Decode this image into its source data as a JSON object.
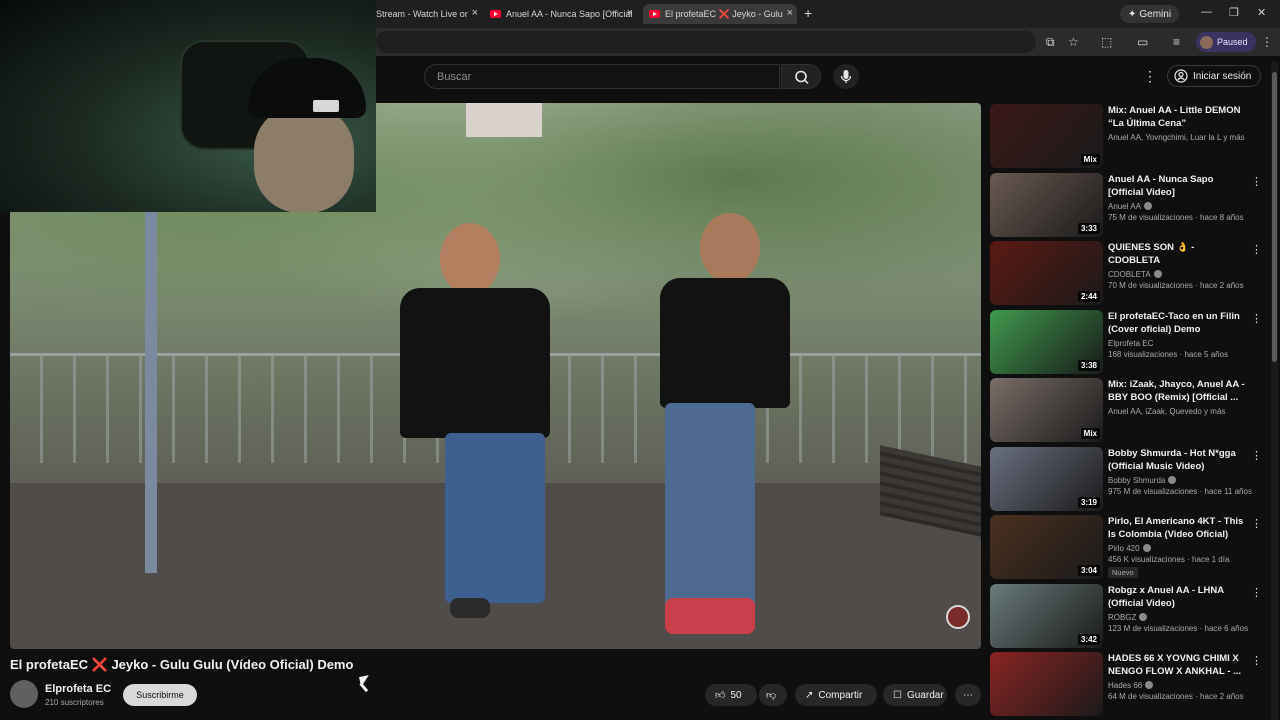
{
  "browser": {
    "tabs": [
      {
        "label": "Stream - Watch Live or",
        "active": false
      },
      {
        "label": "Anuel AA - Nunca Sapo [Official",
        "active": false
      },
      {
        "label": "El profetaEC ❌ Jeyko - Gulu",
        "active": true
      }
    ],
    "gemini_label": "Gemini",
    "paused_label": "Paused"
  },
  "masthead": {
    "search_placeholder": "Buscar",
    "signin_label": "Iniciar sesión"
  },
  "video": {
    "title_part1": "El profetaEC",
    "title_x": "❌",
    "title_part2": "Jeyko - Gulu Gulu (Vídeo Oficial) Demo",
    "channel": "Elprofeta EC",
    "subscribers": "210 suscriptores",
    "subscribe_label": "Suscribirme",
    "likes": "50",
    "share_label": "Compartir",
    "save_label": "Guardar"
  },
  "recommendations": [
    {
      "title": "Mix: Anuel AA - Little DEMON “La Última Cena”",
      "channel": "Anuel AA, Yovngchimi, Luar la L y más",
      "meta": "",
      "duration": "Mix",
      "badge": "",
      "verified": false,
      "thumb_color": "#3a1a18"
    },
    {
      "title": "Anuel AA - Nunca Sapo [Official Video]",
      "channel": "Anuel AA",
      "meta": "75 M de visualizaciones · hace 8 años",
      "duration": "3:33",
      "badge": "",
      "verified": true,
      "thumb_color": "#6a5a52"
    },
    {
      "title": "QUIENES SON 👌 - CDOBLETA",
      "channel": "CDOBLETA",
      "meta": "70 M de visualizaciones · hace 2 años",
      "duration": "2:44",
      "badge": "",
      "verified": true,
      "thumb_color": "#5a1a14"
    },
    {
      "title": "El profetaEC-Taco en un Filin (Cover oficial) Demo",
      "channel": "Elprofeta EC",
      "meta": "168 visualizaciones · hace 5 años",
      "duration": "3:38",
      "badge": "",
      "verified": false,
      "thumb_color": "#3f9a4e"
    },
    {
      "title": "Mix: iZaak, Jhayco, Anuel AA - BBY BOO (Remix) [Official ...",
      "channel": "Anuel AA, iZaak, Quevedo y más",
      "meta": "",
      "duration": "Mix",
      "badge": "",
      "verified": false,
      "thumb_color": "#7a6e68"
    },
    {
      "title": "Bobby Shmurda - Hot N*gga (Official Music Video)",
      "channel": "Bobby Shmurda",
      "meta": "975 M de visualizaciones · hace 11 años",
      "duration": "3:19",
      "badge": "",
      "verified": true,
      "thumb_color": "#6a7080"
    },
    {
      "title": "Pirlo, El Americano 4KT - This Is Colombia (Video Oficial)",
      "channel": "Pirlo 420",
      "meta": "456 K visualizaciones · hace 1 día",
      "duration": "3:04",
      "badge": "Nuevo",
      "verified": true,
      "thumb_color": "#4a3020"
    },
    {
      "title": "Robgz x Anuel AA - LHNA (Official Video)",
      "channel": "ROBGZ",
      "meta": "123 M de visualizaciones · hace 6 años",
      "duration": "3:42",
      "badge": "",
      "verified": true,
      "thumb_color": "#6a7a7a"
    },
    {
      "title": "HADES 66 X YOVNG CHIMI X NENGO FLOW X ANKHAL - ...",
      "channel": "Hades 66",
      "meta": "64 M de visualizaciones · hace 2 años",
      "duration": "",
      "badge": "",
      "verified": true,
      "thumb_color": "#8a2424"
    }
  ]
}
